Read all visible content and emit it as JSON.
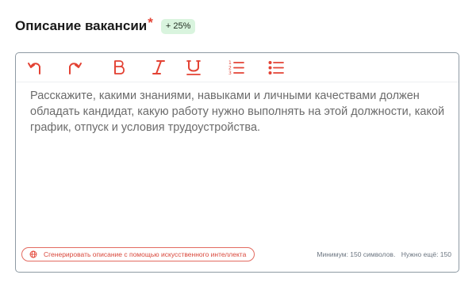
{
  "header": {
    "title": "Описание вакансии",
    "required_mark": "*",
    "badge": "+ 25%"
  },
  "toolbar": {
    "buttons": [
      {
        "name": "undo",
        "icon": "undo-icon"
      },
      {
        "name": "redo",
        "icon": "redo-icon"
      },
      {
        "name": "bold",
        "icon": "bold-icon"
      },
      {
        "name": "italic",
        "icon": "italic-icon"
      },
      {
        "name": "underline",
        "icon": "underline-icon"
      },
      {
        "name": "ordered-list",
        "icon": "ordered-list-icon"
      },
      {
        "name": "bullet-list",
        "icon": "bullet-list-icon"
      }
    ],
    "accent_color": "#e34234"
  },
  "editor": {
    "placeholder": "Расскажите, какими знаниями, навыками и личными качествами должен обладать кандидат, какую работу нужно выполнять на этой должности, какой график, отпуск и условия трудоустройства."
  },
  "footer": {
    "ai_button_label": "Сгенерировать описание с помощью искусственного интеллекта",
    "ai_icon": "globe-icon",
    "minimum_text": "Минимум: 150 символов.",
    "remaining_text": "Нужно ещё: 150"
  },
  "colors": {
    "accent": "#e34234",
    "badge_bg": "#d9f4de",
    "border": "#8e9aa3",
    "placeholder_text": "#6b6b6b"
  }
}
